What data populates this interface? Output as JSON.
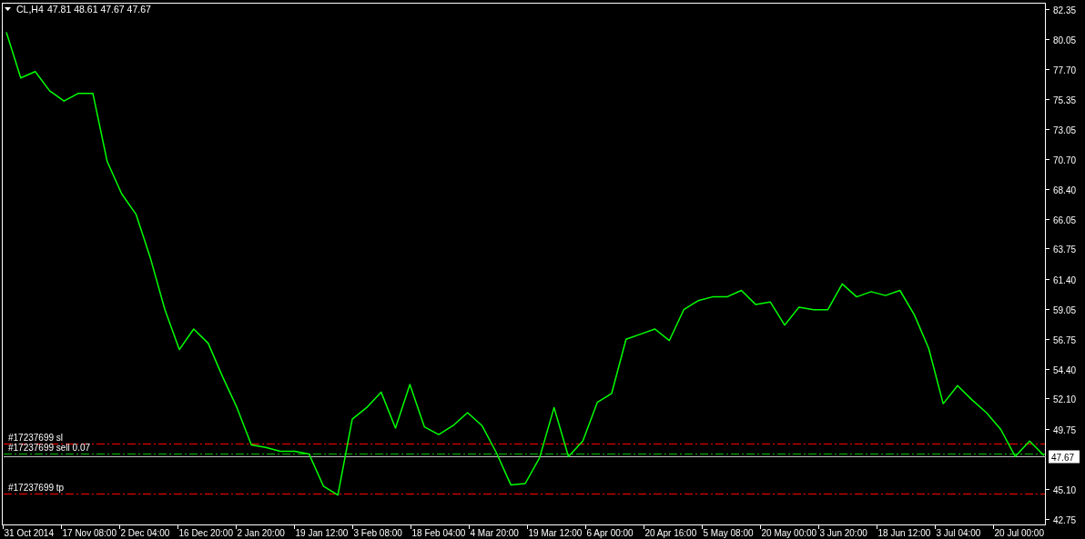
{
  "chart_header": {
    "ohlc": "47.81 48.61 47.67 47.67"
  },
  "chart": {
    "chart_data": {
      "type": "line",
      "ylim": [
        42.25,
        82.77
      ],
      "series": [
        {
          "name": "CL,H4",
          "color": "#00ff00",
          "values": [
            80.54,
            77.0,
            77.5,
            76.0,
            75.2,
            75.8,
            75.8,
            70.5,
            68.0,
            66.4,
            63.0,
            59.0,
            55.9,
            57.5,
            56.4,
            53.8,
            51.4,
            48.5,
            48.3,
            48.0,
            48.0,
            47.8,
            45.3,
            44.6,
            50.5,
            51.4,
            52.6,
            49.8,
            53.2,
            49.9,
            49.3,
            50.0,
            51.0,
            50.0,
            47.9,
            45.4,
            45.5,
            47.5,
            51.4,
            47.6,
            48.8,
            51.8,
            52.5,
            56.7,
            57.1,
            57.5,
            56.6,
            59.0,
            59.7,
            60.0,
            60.0,
            60.5,
            59.4,
            59.6,
            57.8,
            59.2,
            59.0,
            59.0,
            61.0,
            60.0,
            60.4,
            60.1,
            60.5,
            58.6,
            56.0,
            51.7,
            53.1,
            52.0,
            51.0,
            49.7,
            47.6,
            48.8,
            47.67
          ]
        }
      ],
      "yticks": [
        {
          "value": 82.35,
          "label": "82.35"
        },
        {
          "value": 80.05,
          "label": "80.05"
        },
        {
          "value": 77.7,
          "label": "77.70"
        },
        {
          "value": 75.35,
          "label": "75.35"
        },
        {
          "value": 73.05,
          "label": "73.05"
        },
        {
          "value": 70.7,
          "label": "70.70"
        },
        {
          "value": 68.4,
          "label": "68.40"
        },
        {
          "value": 66.05,
          "label": "66.05"
        },
        {
          "value": 63.75,
          "label": "63.75"
        },
        {
          "value": 61.4,
          "label": "61.40"
        },
        {
          "value": 59.05,
          "label": "59.05"
        },
        {
          "value": 56.75,
          "label": "56.75"
        },
        {
          "value": 54.4,
          "label": "54.40"
        },
        {
          "value": 52.1,
          "label": "52.10"
        },
        {
          "value": 49.75,
          "label": "49.75"
        },
        {
          "value": 45.1,
          "label": "45.10"
        },
        {
          "value": 42.75,
          "label": "42.75"
        }
      ],
      "ref_lines": [
        {
          "axis": "y",
          "value": 48.61,
          "label": "#17237699 sl",
          "color": "#ff0000"
        },
        {
          "axis": "y",
          "value": 47.81,
          "label": "#17237699 sell 0.07",
          "color": "#00c000"
        },
        {
          "axis": "y",
          "value": 44.7,
          "label": "#17237699 tp",
          "color": "#ff0000"
        },
        {
          "axis": "y",
          "value": 47.67,
          "label": "47.67",
          "color": "#c0c0c0"
        }
      ]
    },
    "time_labels": [
      "31 Oct 2014",
      "17 Nov 08:00",
      "2 Dec 04:00",
      "16 Dec 20:00",
      "2 Jan 20:00",
      "19 Jan 12:00",
      "3 Feb 08:00",
      "18 Feb 04:00",
      "4 Mar 20:00",
      "19 Mar 12:00",
      "6 Apr 00:00",
      "20 Apr 16:00",
      "5 May 08:00",
      "20 May 00:00",
      "3 Jun 20:00",
      "18 Jun 12:00",
      "3 Jul 04:00",
      "20 Jul 00:00"
    ]
  }
}
